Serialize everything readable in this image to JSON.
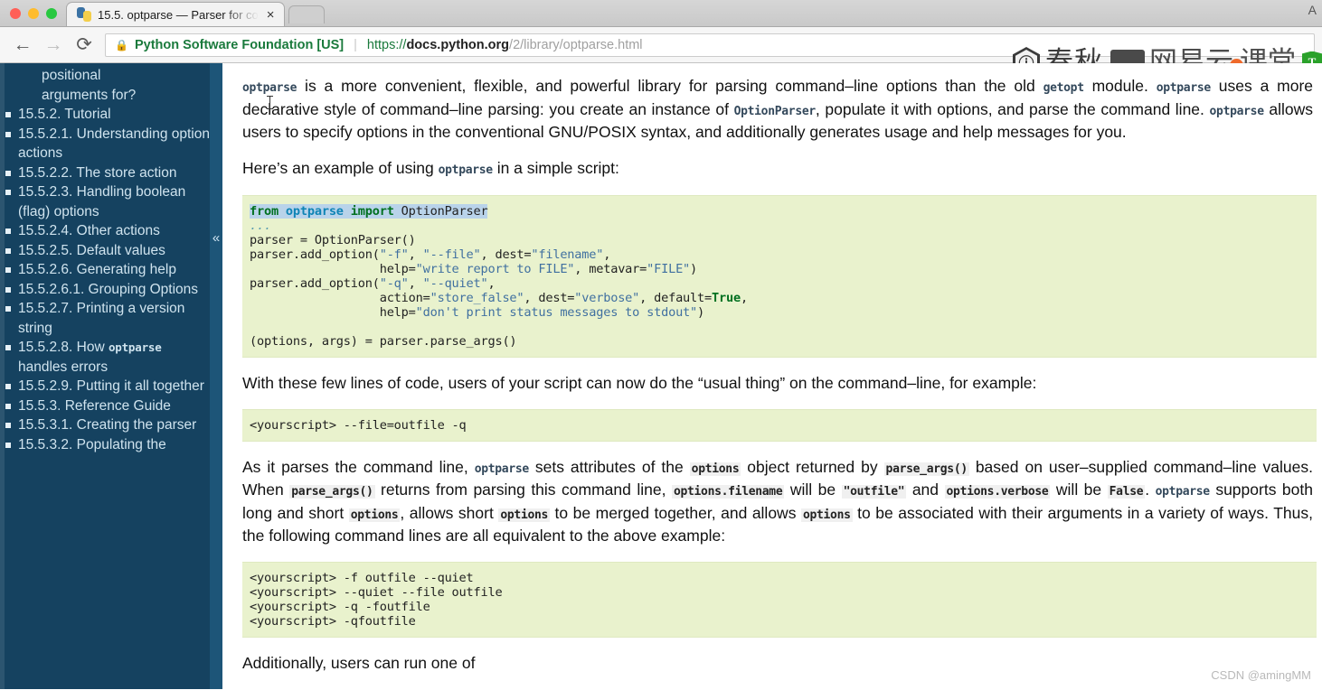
{
  "window": {
    "traffic_lights": [
      "close",
      "minimize",
      "maximize"
    ],
    "corner_label": "A"
  },
  "tab": {
    "title": "15.5. optparse — Parser for co",
    "close_label": "×",
    "favicon": "python-logo-icon"
  },
  "toolbar": {
    "back_label": "←",
    "forward_label": "→",
    "reload_label": "⟳"
  },
  "address_bar": {
    "lock_icon": "lock-icon",
    "security_label": "Python Software Foundation [US]",
    "url_scheme": "https://",
    "url_host": "docs.python.org",
    "url_path": "/2/library/optparse.html"
  },
  "watermarks": {
    "chunqiu_glyph": "ⓘ",
    "chunqiu_text": "春秋",
    "netease_text_1": "网易云",
    "netease_text_2": "课堂",
    "shield_letter": "T",
    "csdn": "CSDN @amingMM"
  },
  "sidebar": {
    "collapse_icon": "«",
    "orphan_lines": [
      "positional",
      "arguments for?"
    ],
    "items": [
      {
        "level": 1,
        "label": "15.5.2. Tutorial"
      },
      {
        "level": 2,
        "label": "15.5.2.1. Understanding option actions"
      },
      {
        "level": 2,
        "label": "15.5.2.2. The store action"
      },
      {
        "level": 2,
        "label": "15.5.2.3. Handling boolean (flag) options"
      },
      {
        "level": 2,
        "label": "15.5.2.4. Other actions"
      },
      {
        "level": 2,
        "label": "15.5.2.5. Default values"
      },
      {
        "level": 2,
        "label": "15.5.2.6. Generating help"
      },
      {
        "level": 3,
        "label": "15.5.2.6.1. Grouping Options"
      },
      {
        "level": 2,
        "label": "15.5.2.7. Printing a version string"
      },
      {
        "level": 2,
        "label": "15.5.2.8. How optparse handles errors",
        "code_part": "optparse"
      },
      {
        "level": 2,
        "label": "15.5.2.9. Putting it all together"
      },
      {
        "level": 1,
        "label": "15.5.3. Reference Guide"
      },
      {
        "level": 2,
        "label": "15.5.3.1. Creating the parser"
      },
      {
        "level": 2,
        "label": "15.5.3.2. Populating the"
      }
    ]
  },
  "main": {
    "paragraph_1": "optparse is a more convenient, flexible, and powerful library for parsing command–line options than the old getopt module. optparse uses a more declarative style of command–line parsing: you create an instance of OptionParser, populate it with options, and parse the command line. optparse allows users to specify options in the conventional GNU/POSIX syntax, and additionally generates usage and help messages for you.",
    "paragraph_2": "Here’s an example of using optparse in a simple script:",
    "code_block_1": "from optparse import OptionParser\n...\nparser = OptionParser()\nparser.add_option(\"-f\", \"--file\", dest=\"filename\",\n                  help=\"write report to FILE\", metavar=\"FILE\")\nparser.add_option(\"-q\", \"--quiet\",\n                  action=\"store_false\", dest=\"verbose\", default=True,\n                  help=\"don't print status messages to stdout\")\n\n(options, args) = parser.parse_args()",
    "paragraph_3": "With these few lines of code, users of your script can now do the “usual thing” on the command–line, for example:",
    "code_block_2": "<yourscript> --file=outfile -q",
    "paragraph_4": "As it parses the command line, optparse sets attributes of the options object returned by parse_args() based on user–supplied command–line values. When parse_args() returns from parsing this command line, options.filename will be \"outfile\" and options.verbose will be False. optparse supports both long and short options, allows short options to be merged together, and allows options to be associated with their arguments in a variety of ways. Thus, the following command lines are all equivalent to the above example:",
    "code_block_3": "<yourscript> -f outfile --quiet\n<yourscript> --quiet --file outfile\n<yourscript> -q -foutfile\n<yourscript> -qfoutfile",
    "paragraph_5": "Additionally, users can run one of"
  }
}
